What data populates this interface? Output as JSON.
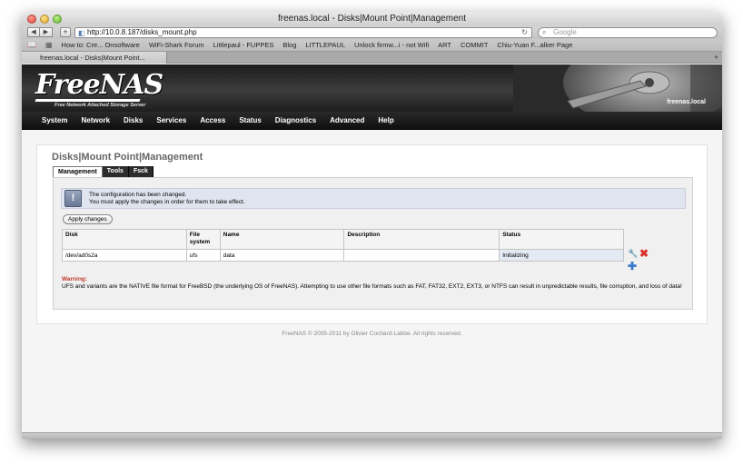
{
  "window": {
    "title": "freenas.local - Disks|Mount Point|Management"
  },
  "toolbar": {
    "back_icon": "back-arrow",
    "forward_icon": "forward-arrow",
    "url": "http://10.0.8.187/disks_mount.php",
    "search_placeholder": "Google"
  },
  "bookmarks": {
    "items": [
      "How to: Cre... Onsoftware",
      "WiFi-Shark Forum",
      "Littlepaul - FUPPES",
      "Blog",
      "LITTLEPAUL",
      "Unlock firmw...i - not Wifi",
      "ART",
      "COMMIT",
      "Chiu-Yuan F...alker Page"
    ]
  },
  "tab": {
    "label": "freenas.local - Disks|Mount Point..."
  },
  "banner": {
    "logo": "FreeNAS",
    "tagline": "Free Network Attached Storage Server",
    "hostname": "freenas.local"
  },
  "menu": {
    "items": [
      "System",
      "Network",
      "Disks",
      "Services",
      "Access",
      "Status",
      "Diagnostics",
      "Advanced",
      "Help"
    ]
  },
  "page": {
    "title": "Disks|Mount Point|Management",
    "tabs": [
      "Management",
      "Tools",
      "Fsck"
    ],
    "notice_line1": "The configuration has been changed.",
    "notice_line2": "You must apply the changes in order for them to take effect.",
    "apply_button": "Apply changes",
    "table": {
      "headers": [
        "Disk",
        "File system",
        "Name",
        "Description",
        "Status"
      ],
      "rows": [
        [
          "/dev/ad0s2a",
          "ufs",
          "data",
          "",
          "Initializing"
        ]
      ]
    },
    "warning_title": "Warning:",
    "warning_text": "UFS and variants are the NATIVE file format for FreeBSD (the underlying OS of FreeNAS). Attempting to use other file formats such as FAT, FAT32, EXT2, EXT3, or NTFS can result in unpredictable results, file corruption, and loss of data!"
  },
  "footer": {
    "text": "FreeNAS © 2005-2011 by Olivier Cochard-Labbe. All rights reserved."
  },
  "colors": {
    "menu_bg": "#1a1a1a",
    "notice_bg": "#dfe4ee",
    "warning": "#c0392b",
    "delete": "#d8312a",
    "add": "#3a78c8"
  }
}
